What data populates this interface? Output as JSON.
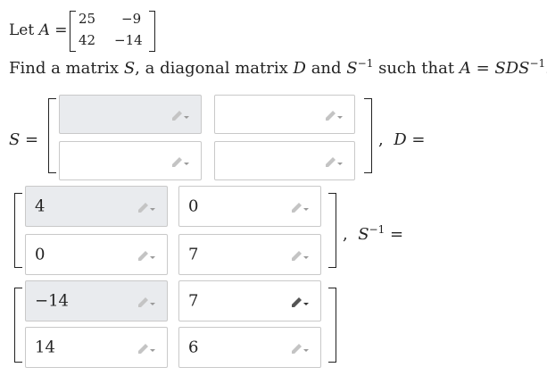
{
  "prompt": {
    "let_label": "Let",
    "a_symbol": "A",
    "equals": "=",
    "matrix_a": [
      [
        "25",
        "−9"
      ],
      [
        "42",
        "−14"
      ]
    ],
    "find_text_1": "Find a matrix",
    "s_symbol": "S",
    "find_text_2": ", a diagonal matrix",
    "d_symbol": "D",
    "find_text_3": "and",
    "sinv_symbol": "S",
    "sinv_exp": "−1",
    "find_text_4": "such that",
    "equation": "A = SDS",
    "equation_exp": "−1",
    "period": "."
  },
  "labels": {
    "s_eq": "S =",
    "comma_1": ",",
    "d_eq": "D =",
    "comma_2": ",",
    "sinv_eq_base": "S",
    "sinv_eq_exp": "−1",
    "sinv_eq_tail": "="
  },
  "matrix_s": {
    "cells": [
      "",
      "",
      "",
      ""
    ]
  },
  "matrix_d": {
    "cells": [
      "4",
      "0",
      "0",
      "7"
    ]
  },
  "matrix_sinv": {
    "cells": [
      "−14",
      "7",
      "14",
      "6"
    ]
  },
  "icons": {
    "edit": "pencil-icon"
  },
  "colors": {
    "shaded_box": "#e9ebee",
    "box_border": "#c9c9c9",
    "text": "#222222"
  }
}
